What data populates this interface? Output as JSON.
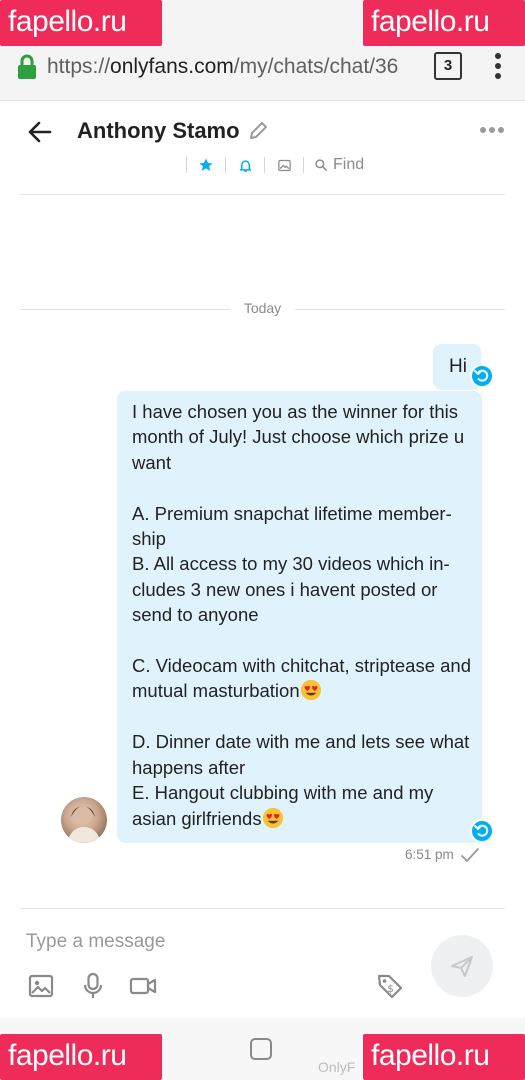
{
  "browser": {
    "url_prefix": "https://",
    "url_host": "onlyfans.com",
    "url_path": "/my/chats/chat/36",
    "tab_count": "3"
  },
  "watermark": "fapello.ru",
  "chat": {
    "contact_name": "Anthony Stamo",
    "find_label": "Find",
    "date_label": "Today"
  },
  "messages": {
    "hi": "Hi",
    "main_p1": "I have chosen you as the winner for this month of July! Just choose which prize u want\n\nA. Premium snapchat lifetime member-ship\nB. All access to my 30 videos which in-cludes 3 new ones i havent posted or send to anyone\n\nC. Videocam with chitchat, striptease and mutual masturbation",
    "main_p2": "\n\nD. Dinner date with me and lets see what happens after\nE. Hangout clubbing with me and my asian girlfriends",
    "time": "6:51 pm"
  },
  "composer": {
    "placeholder": "Type a message"
  },
  "navbar": {
    "label": "OnlyF"
  },
  "colors": {
    "accent": "#00aff0",
    "bubble": "#e0f3fd",
    "watermark": "#ef2b5a",
    "lock": "#2e9e3f"
  },
  "icons": [
    "lock-icon",
    "menu-dots-icon",
    "back-arrow-icon",
    "edit-icon",
    "more-icon",
    "star-icon",
    "bell-icon",
    "image-icon",
    "search-icon",
    "undo-icon",
    "check-icon",
    "mic-icon",
    "video-icon",
    "price-tag-icon",
    "send-icon",
    "home-icon"
  ]
}
